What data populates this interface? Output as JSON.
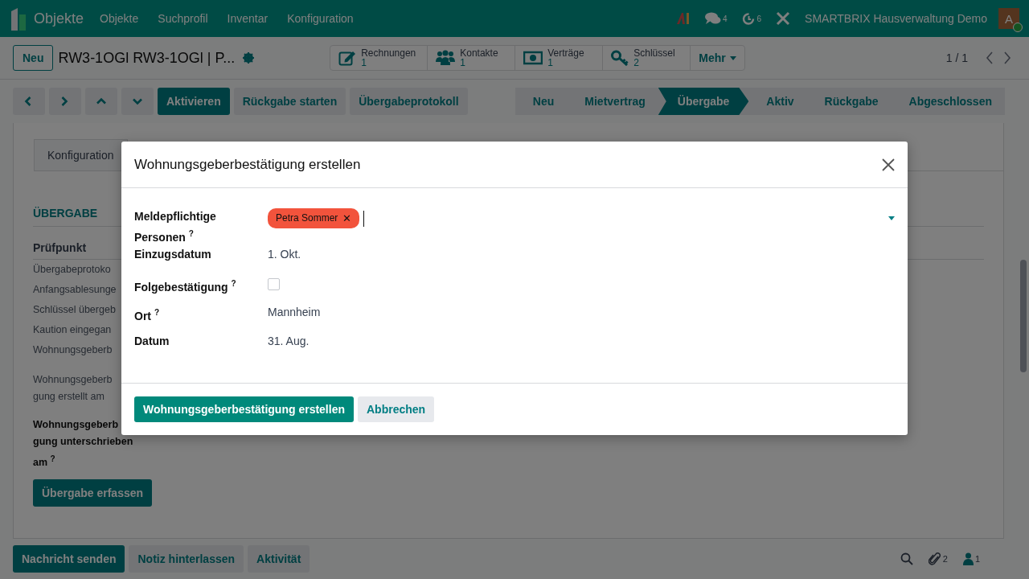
{
  "navbar": {
    "app_name": "Objekte",
    "menu": [
      "Objekte",
      "Suchprofil",
      "Inventar",
      "Konfiguration"
    ],
    "messages_count": "4",
    "activities_count": "6",
    "company": "SMARTBRIX Hausverwaltung Demo",
    "avatar_initial": "A"
  },
  "control_panel": {
    "new_button": "Neu",
    "breadcrumb": "RW3-1OGl RW3-1OGl | P...",
    "smart_buttons": [
      {
        "kind": "edit",
        "label": "Rechnungen",
        "count": "1"
      },
      {
        "kind": "users",
        "label": "Kontakte",
        "count": "1"
      },
      {
        "kind": "money",
        "label": "Verträge",
        "count": "1"
      },
      {
        "kind": "key",
        "label": "Schlüssel",
        "count": "2"
      }
    ],
    "more_button": "Mehr",
    "pager": "1 / 1"
  },
  "action_bar": {
    "buttons": [
      {
        "label": "Aktivieren",
        "primary": true
      },
      {
        "label": "Rückgabe starten",
        "primary": false
      },
      {
        "label": "Übergabeprotokoll",
        "primary": false
      }
    ],
    "stages": [
      {
        "label": "Neu",
        "selected": false
      },
      {
        "label": "Mietvertrag",
        "selected": false
      },
      {
        "label": "Übergabe",
        "selected": true
      },
      {
        "label": "Aktiv",
        "selected": false
      },
      {
        "label": "Rückgabe",
        "selected": false
      },
      {
        "label": "Abgeschlossen",
        "selected": false
      }
    ]
  },
  "sheet": {
    "tabs": [
      "Konfiguration"
    ],
    "section_title": "ÜBERGABE",
    "column_header": "Prüfpunkt",
    "rows": [
      "Übergabeprotoko",
      "Anfangsablesunge",
      "Schlüssel übergeb",
      "Kaution eingegan",
      "Wohnungsgeberb"
    ],
    "fields": [
      {
        "label": "Wohnungsgeberb\ngung erstellt am",
        "bold": false
      },
      {
        "label": "Wohnungsgeberb\ngung unterschrieben\nam",
        "bold": true,
        "help": "?"
      }
    ],
    "button": "Übergabe erfassen"
  },
  "chatter": {
    "buttons": [
      {
        "label": "Nachricht senden",
        "primary": true
      },
      {
        "label": "Notiz hinterlassen",
        "primary": false
      },
      {
        "label": "Aktivität",
        "primary": false
      }
    ],
    "attachments_count": "2",
    "followers_count": "1"
  },
  "dialog": {
    "title": "Wohnungsgeberbestätigung erstellen",
    "fields": [
      {
        "kind": "tags",
        "label": "Meldepflichtige Personen",
        "help": "?",
        "tags": [
          {
            "label": "Petra Sommer",
            "color": "#f2533c",
            "remove": "✕"
          }
        ]
      },
      {
        "kind": "text",
        "label": "Einzugsdatum",
        "value": "1. Okt."
      },
      {
        "kind": "checkbox",
        "label": "Folgebestätigung",
        "help": "?",
        "checked": false
      },
      {
        "kind": "text",
        "label": "Ort",
        "help": "?",
        "value": "Mannheim"
      },
      {
        "kind": "text",
        "label": "Datum",
        "value": "31. Aug."
      }
    ],
    "buttons": [
      {
        "label": "Wohnungsgeberbestätigung erstellen",
        "primary": true
      },
      {
        "label": "Abbrechen",
        "primary": false
      }
    ]
  }
}
